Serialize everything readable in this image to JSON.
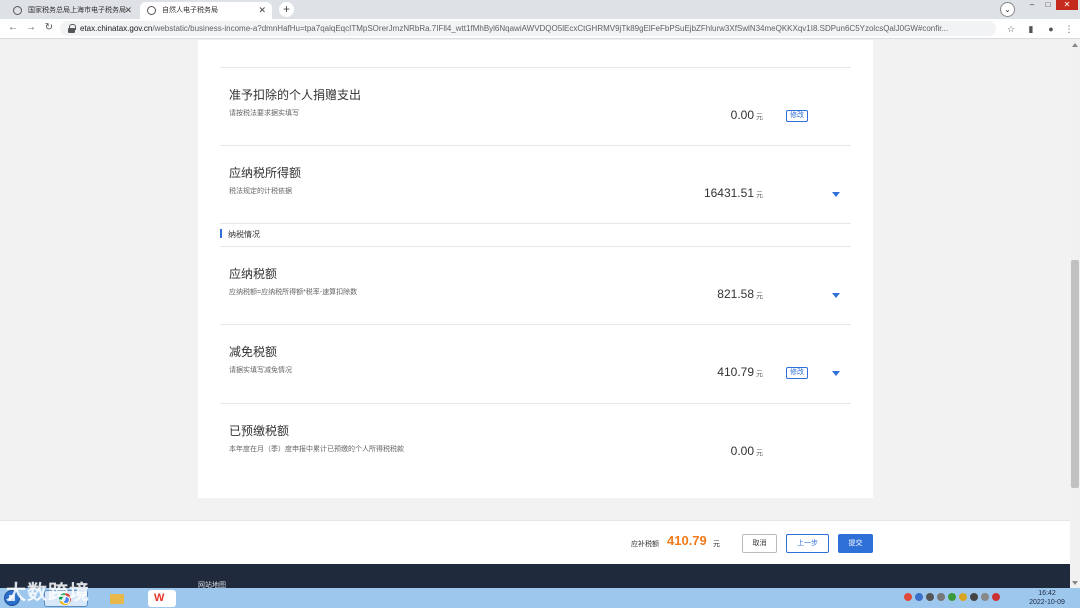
{
  "browser": {
    "tabs": [
      {
        "title": "国家税务总局上海市电子税务局",
        "active": false
      },
      {
        "title": "自然人电子税务局",
        "active": true
      }
    ],
    "url_host": "etax.chinatax.gov.cn",
    "url_path": "/webstatic/business-income-a?dmnHafHu=tpa7qalqEqcITMpSOrerJmzNRbRa.7IFll4_wtt1fMhByl6NqawiAWVDQO5lEcxCtGHRMV9jTk89gElFeFbPSuEjbZFhlurw3XfSwlN34meQKKXqv1I8.SDPun6C5YzolcsQalJ0GW#confir..."
  },
  "rows": [
    {
      "label": "准予扣除的个人捐赠支出",
      "sub": "请按税法要求据实填写",
      "value": "0.00",
      "unit": "元",
      "modify": "修改",
      "expand": false
    },
    {
      "label": "应纳税所得额",
      "sub": "税法规定的计税依据",
      "value": "16431.51",
      "unit": "元",
      "modify": "",
      "expand": true
    },
    {
      "label": "应纳税额",
      "sub": "应纳税额=应纳税所得额*税率-速算扣除数",
      "value": "821.58",
      "unit": "元",
      "modify": "",
      "expand": true
    },
    {
      "label": "减免税额",
      "sub": "请据实填写减免情况",
      "value": "410.79",
      "unit": "元",
      "modify": "修改",
      "expand": true
    },
    {
      "label": "已预缴税额",
      "sub": "本年度在月（季）度申报中累计已预缴的个人所得税税款",
      "value": "0.00",
      "unit": "元",
      "modify": "",
      "expand": false
    }
  ],
  "section_title": "纳税情况",
  "footer": {
    "due_label": "应补税额",
    "due_amount": "410.79",
    "due_unit": "元",
    "cancel": "取消",
    "prev": "上一步",
    "submit": "提交"
  },
  "dark_band": {
    "sitemap": "网站地图"
  },
  "watermark": "大数跨境",
  "clock": {
    "time": "16:42",
    "date": "2022-10-09"
  },
  "colors": {
    "accent": "#2f6fd8",
    "due": "#f07a1a"
  }
}
